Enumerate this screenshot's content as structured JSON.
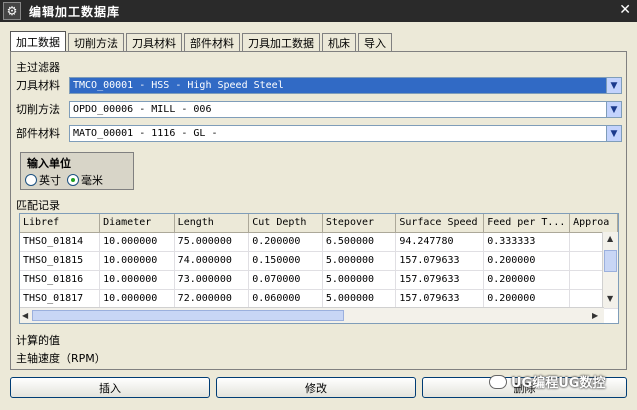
{
  "window": {
    "title": "编辑加工数据库",
    "close_glyph": "✕"
  },
  "tabs": [
    {
      "label": "加工数据"
    },
    {
      "label": "切削方法"
    },
    {
      "label": "刀具材料"
    },
    {
      "label": "部件材料"
    },
    {
      "label": "刀具加工数据"
    },
    {
      "label": "机床"
    },
    {
      "label": "导入"
    }
  ],
  "filters": {
    "heading": "主过滤器",
    "tool_material": {
      "label": "刀具材料",
      "value": "TMCO_00001 - HSS - High Speed Steel"
    },
    "cut_method": {
      "label": "切削方法",
      "value": "OPDO_00006 - MILL - 006"
    },
    "part_material": {
      "label": "部件材料",
      "value": "MATO_00001 - 1116 - GL -"
    }
  },
  "units": {
    "heading": "输入单位",
    "options": [
      "英寸",
      "毫米"
    ],
    "selected": "毫米"
  },
  "matches": {
    "heading": "匹配记录",
    "columns": [
      "Libref",
      "Diameter",
      "Length",
      "Cut Depth",
      "Stepover",
      "Surface Speed",
      "Feed per T...",
      "Approa"
    ],
    "rows": [
      [
        "THSO_01814",
        "10.000000",
        "75.000000",
        "0.200000",
        "6.500000",
        "94.247780",
        "0.333333",
        ""
      ],
      [
        "THSO_01815",
        "10.000000",
        "74.000000",
        "0.150000",
        "5.000000",
        "157.079633",
        "0.200000",
        ""
      ],
      [
        "THSO_01816",
        "10.000000",
        "73.000000",
        "0.070000",
        "5.000000",
        "157.079633",
        "0.200000",
        ""
      ],
      [
        "THSO_01817",
        "10.000000",
        "72.000000",
        "0.060000",
        "5.000000",
        "157.079633",
        "0.200000",
        ""
      ]
    ]
  },
  "computed": {
    "heading": "计算的值",
    "spindle_label": "主轴速度（RPM）"
  },
  "buttons": {
    "insert": "插入",
    "modify": "修改",
    "delete": "删除"
  },
  "watermark": "UG编程UG数控"
}
